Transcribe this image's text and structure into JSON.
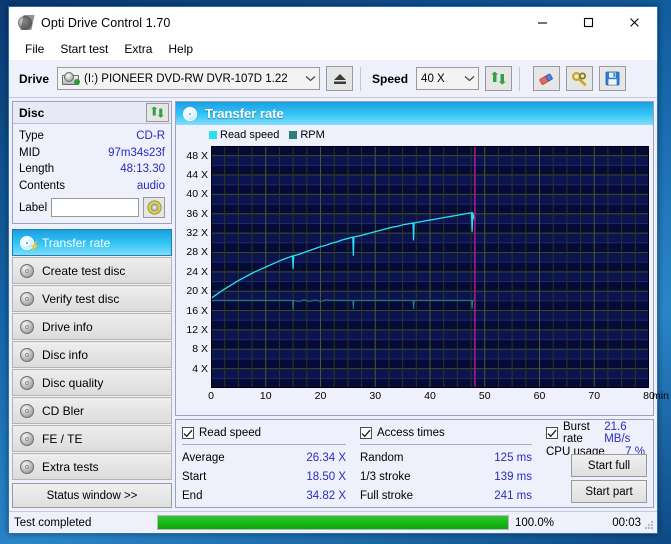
{
  "window": {
    "title": "Opti Drive Control 1.70",
    "app_icon": "disc-icon",
    "minimize": "—",
    "maximize": "□",
    "close": "✕"
  },
  "menu": [
    {
      "label": "File"
    },
    {
      "label": "Start test"
    },
    {
      "label": "Extra"
    },
    {
      "label": "Help"
    }
  ],
  "toolbar": {
    "drive_label": "Drive",
    "drive_value": "(I:)  PIONEER DVD-RW  DVR-107D 1.22",
    "eject_icon": "eject-icon",
    "speed_label": "Speed",
    "speed_value": "40 X",
    "refresh_icon": "refresh-icon",
    "erase_icon": "eraser-icon",
    "settings_icon": "wrench-icon",
    "save_icon": "floppy-save-icon"
  },
  "disc": {
    "header": "Disc",
    "refresh_icon": "refresh-icon",
    "rows": [
      {
        "key": "Type",
        "value": "CD-R"
      },
      {
        "key": "MID",
        "value": "97m34s23f"
      },
      {
        "key": "Length",
        "value": "48:13.30"
      },
      {
        "key": "Contents",
        "value": "audio"
      }
    ],
    "label_key": "Label",
    "label_value": "",
    "label_placeholder": "",
    "label_button_icon": "cd-icon"
  },
  "nav": {
    "items": [
      {
        "label": "Transfer rate",
        "selected": true
      },
      {
        "label": "Create test disc",
        "selected": false
      },
      {
        "label": "Verify test disc",
        "selected": false
      },
      {
        "label": "Drive info",
        "selected": false
      },
      {
        "label": "Disc info",
        "selected": false
      },
      {
        "label": "Disc quality",
        "selected": false
      },
      {
        "label": "CD Bler",
        "selected": false
      },
      {
        "label": "FE / TE",
        "selected": false
      },
      {
        "label": "Extra tests",
        "selected": false
      }
    ],
    "status_window_button": "Status window >>"
  },
  "chart_panel": {
    "header": "Transfer rate",
    "header_icon": "disc-icon"
  },
  "chart_data": {
    "type": "line",
    "title": "Transfer rate",
    "xlabel": "min",
    "ylabel": "X",
    "xlim": [
      0,
      80
    ],
    "ylim": [
      0,
      50
    ],
    "xticks": [
      0,
      10,
      20,
      30,
      40,
      50,
      60,
      70,
      80
    ],
    "yticks": [
      4,
      8,
      12,
      16,
      20,
      24,
      28,
      32,
      36,
      40,
      44,
      48
    ],
    "ytick_suffix": " X",
    "xunit": "min",
    "grid": true,
    "background": "#050a38",
    "legend_position": "top-left",
    "marker_x": 48.2,
    "marker_color": "#c01a8c",
    "series": [
      {
        "name": "Read speed",
        "color": "#2ae0f0",
        "x": [
          0.0,
          1.0,
          2.0,
          3.0,
          4.0,
          5.0,
          6.0,
          7.0,
          8.0,
          9.0,
          10.0,
          11.0,
          12.0,
          13.0,
          14.0,
          14.9,
          15.0,
          15.1,
          15.4,
          16.0,
          17.0,
          18.0,
          19.0,
          20.0,
          21.0,
          22.0,
          23.0,
          24.0,
          25.0,
          25.9,
          26.0,
          26.1,
          26.5,
          27.0,
          28.0,
          29.0,
          30.0,
          31.0,
          32.0,
          33.0,
          34.0,
          35.0,
          36.0,
          36.9,
          37.0,
          37.1,
          37.5,
          38.0,
          39.0,
          40.0,
          41.0,
          42.0,
          43.0,
          44.0,
          45.0,
          46.0,
          47.0,
          47.6,
          47.7,
          47.8,
          48.1,
          48.2
        ],
        "y": [
          18.5,
          19.3,
          20.1,
          20.8,
          21.5,
          22.2,
          22.8,
          23.4,
          24.0,
          24.5,
          25.0,
          25.5,
          26.0,
          26.5,
          26.9,
          27.3,
          24.7,
          27.3,
          27.4,
          27.6,
          28.0,
          28.4,
          28.8,
          29.2,
          29.5,
          29.9,
          30.2,
          30.6,
          30.9,
          31.2,
          27.4,
          31.2,
          31.3,
          31.4,
          31.7,
          32.0,
          32.3,
          32.6,
          32.9,
          33.2,
          33.4,
          33.7,
          33.9,
          34.1,
          30.6,
          34.1,
          34.2,
          34.3,
          34.5,
          34.7,
          34.9,
          35.1,
          35.3,
          35.5,
          35.7,
          35.9,
          36.1,
          36.2,
          32.4,
          36.2,
          34.8,
          34.8
        ]
      },
      {
        "name": "RPM",
        "color": "#2d7f7f",
        "x": [
          0.0,
          1.0,
          5.0,
          10.0,
          13.0,
          14.0,
          14.9,
          15.0,
          15.1,
          16.0,
          17.0,
          18.0,
          19.0,
          20.0,
          21.0,
          22.0,
          23.0,
          25.9,
          26.0,
          26.1,
          27.0,
          30.0,
          35.0,
          36.9,
          37.0,
          37.1,
          38.0,
          42.0,
          45.0,
          47.6,
          47.7,
          47.8,
          48.2
        ],
        "y": [
          18.1,
          18.1,
          18.1,
          18.1,
          18.1,
          18.1,
          18.1,
          16.2,
          18.1,
          17.9,
          18.2,
          17.9,
          18.2,
          17.9,
          18.2,
          18.1,
          18.1,
          18.1,
          16.4,
          18.1,
          18.1,
          18.1,
          18.1,
          18.1,
          16.4,
          18.1,
          18.1,
          18.1,
          18.1,
          18.1,
          16.5,
          18.1,
          18.1
        ]
      }
    ],
    "legend": [
      {
        "label": "Read speed",
        "color": "#2ae0f0"
      },
      {
        "label": "RPM",
        "color": "#2d7f7f"
      }
    ]
  },
  "results": {
    "read_speed": {
      "checkbox_label": "Read speed",
      "checked": true,
      "rows": [
        {
          "key": "Average",
          "value": "26.34 X"
        },
        {
          "key": "Start",
          "value": "18.50 X"
        },
        {
          "key": "End",
          "value": "34.82 X"
        }
      ]
    },
    "access_times": {
      "checkbox_label": "Access times",
      "checked": true,
      "rows": [
        {
          "key": "Random",
          "value": "125 ms"
        },
        {
          "key": "1/3 stroke",
          "value": "139 ms"
        },
        {
          "key": "Full stroke",
          "value": "241 ms"
        }
      ]
    },
    "burst": {
      "checkbox_label": "Burst rate",
      "checked": true,
      "burst_value": "21.6 MB/s",
      "cpu_key": "CPU usage",
      "cpu_value": "7 %"
    },
    "buttons": [
      {
        "label": "Start full"
      },
      {
        "label": "Start part"
      }
    ]
  },
  "statusbar": {
    "text": "Test completed",
    "progress_percent_label": "100.0%",
    "progress_value": 100,
    "elapsed": "00:03"
  }
}
